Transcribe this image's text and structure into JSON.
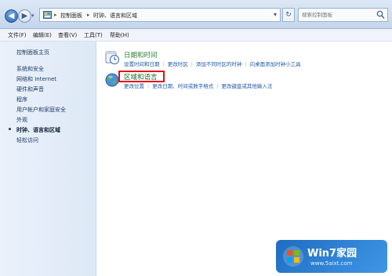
{
  "navigation": {
    "back_icon": "back-arrow-icon",
    "forward_icon": "forward-arrow-icon"
  },
  "address_bar": {
    "crumbs": [
      "控制面板",
      "时钟、语言和区域"
    ]
  },
  "search": {
    "placeholder": "搜索控制面板"
  },
  "menubar": {
    "items": [
      "文件(F)",
      "编辑(E)",
      "查看(V)",
      "工具(T)",
      "帮助(H)"
    ]
  },
  "sidebar": {
    "home": "控制面板主页",
    "items": [
      "系统和安全",
      "网络和 Internet",
      "硬件和声音",
      "程序",
      "用户帐户和家庭安全",
      "外观",
      "时钟、语言和区域",
      "轻松访问"
    ],
    "active_index": 6
  },
  "categories": [
    {
      "title": "日期和时间",
      "icon": "clock-icon",
      "links": [
        "设置时间和日期",
        "更改时区",
        "添加不同时区的时钟",
        "向桌面添加时钟小工具"
      ]
    },
    {
      "title": "区域和语言",
      "icon": "globe-icon",
      "links": [
        "更改位置",
        "更改日期、时间或数字格式",
        "更改键盘或其他输入法"
      ]
    }
  ],
  "watermark": {
    "brand": "Win7家园",
    "url": "www.5aixt.com"
  },
  "colors": {
    "link": "#1e5aa8",
    "category_title": "#2d7d32",
    "highlight": "#e01010",
    "sidebar_bg": "#e3ecf8"
  }
}
